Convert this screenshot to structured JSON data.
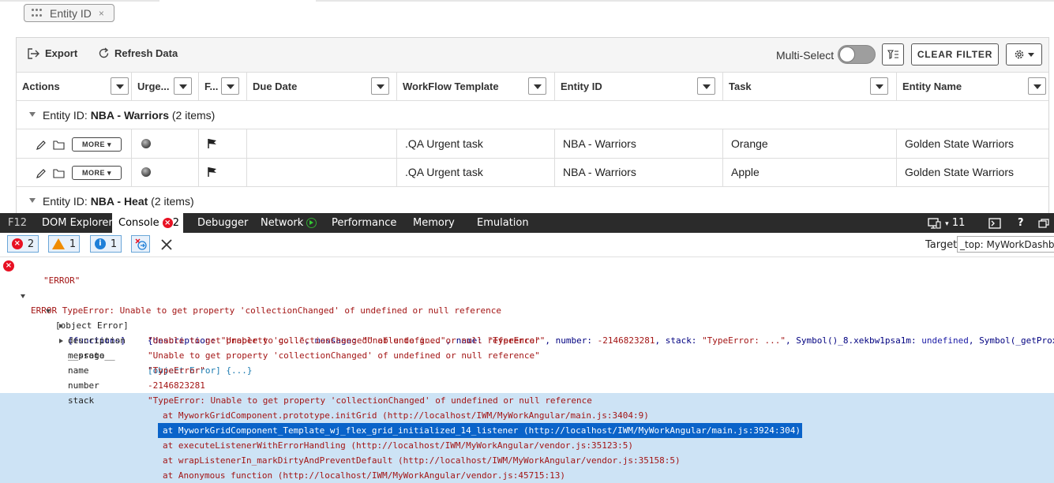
{
  "filter_chip": {
    "label": "Entity ID",
    "close": "×"
  },
  "toolbar": {
    "export_label": "Export",
    "refresh_label": "Refresh Data",
    "multiselect_label": "Multi-Select",
    "multiselect_on": false,
    "clear_filter_label": "CLEAR FILTER"
  },
  "columns": [
    "Actions",
    "Urge...",
    "F...",
    "Due Date",
    "WorkFlow Template",
    "Entity ID",
    "Task",
    "Entity Name"
  ],
  "groups": [
    {
      "prefix": "Entity ID: ",
      "name": "NBA - Warriors",
      "count": " (2 items)",
      "rows": [
        {
          "more": "MORE",
          "due": "",
          "template": ".QA Urgent task",
          "entity_id": "NBA - Warriors",
          "task": "Orange",
          "entity_name": "Golden State Warriors"
        },
        {
          "more": "MORE",
          "due": "",
          "template": ".QA Urgent task",
          "entity_id": "NBA - Warriors",
          "task": "Apple",
          "entity_name": "Golden State Warriors"
        }
      ]
    },
    {
      "prefix": "Entity ID: ",
      "name": "NBA - Heat",
      "count": " (2 items)"
    }
  ],
  "devtools": {
    "tabs": [
      "F12",
      "DOM Explorer",
      "Console",
      "Debugger",
      "Network",
      "Performance",
      "Memory",
      "Emulation"
    ],
    "console_error_count": "2",
    "right_count": "11",
    "filters": {
      "errors": "2",
      "warnings": "1",
      "info": "1"
    },
    "target_label": "Target",
    "target_value": "_top: MyWorkDashboard"
  },
  "console": {
    "error_line": "ERROR TypeError: Unable to get property 'collectionChanged' of undefined or null reference",
    "error_str": "\"ERROR\"",
    "obj_label": "[object Error]",
    "obj_summary_1": "{description: ",
    "obj_summary_2": "\"Unable to g...\"",
    "obj_summary_3": ", message: ",
    "obj_summary_4": "\"Unable to g...\"",
    "obj_summary_5": ", name: ",
    "obj_summary_6": "\"TypeError\"",
    "obj_summary_7": ", number: ",
    "obj_summary_8": "-2146823281",
    "obj_summary_9": ", stack: ",
    "obj_summary_10": "\"TypeError: ...\"",
    "obj_summary_11": ", Symbol()_8.xekbw1psa1m: ",
    "obj_summary_12": "undefined",
    "obj_summary_13": ", Symbol(_getProx",
    "functions": "[functions]",
    "proto_key": "__proto__",
    "proto_val": "[object Error] {...}",
    "props": [
      {
        "key": "description",
        "val": "\"Unable to get property 'collectionChanged' of undefined or null reference\""
      },
      {
        "key": "message",
        "val": "\"Unable to get property 'collectionChanged' of undefined or null reference\""
      },
      {
        "key": "name",
        "val": "\"TypeError\""
      },
      {
        "key": "number",
        "val": "-2146823281"
      },
      {
        "key": "stack",
        "val": "\"TypeError: Unable to get property 'collectionChanged' of undefined or null reference"
      }
    ],
    "stack_lines": [
      "at MyworkGridComponent.prototype.initGrid (http://localhost/IWM/MyWorkAngular/main.js:3404:9)",
      "at MyworkGridComponent_Template_wj_flex_grid_initialized_14_listener (http://localhost/IWM/MyWorkAngular/main.js:3924:304)",
      "at executeListenerWithErrorHandling (http://localhost/IWM/MyWorkAngular/vendor.js:35123:5)",
      "at wrapListenerIn_markDirtyAndPreventDefault (http://localhost/IWM/MyWorkAngular/vendor.js:35158:5)",
      "at Anonymous function (http://localhost/IWM/MyWorkAngular/vendor.js:45715:13)"
    ]
  }
}
